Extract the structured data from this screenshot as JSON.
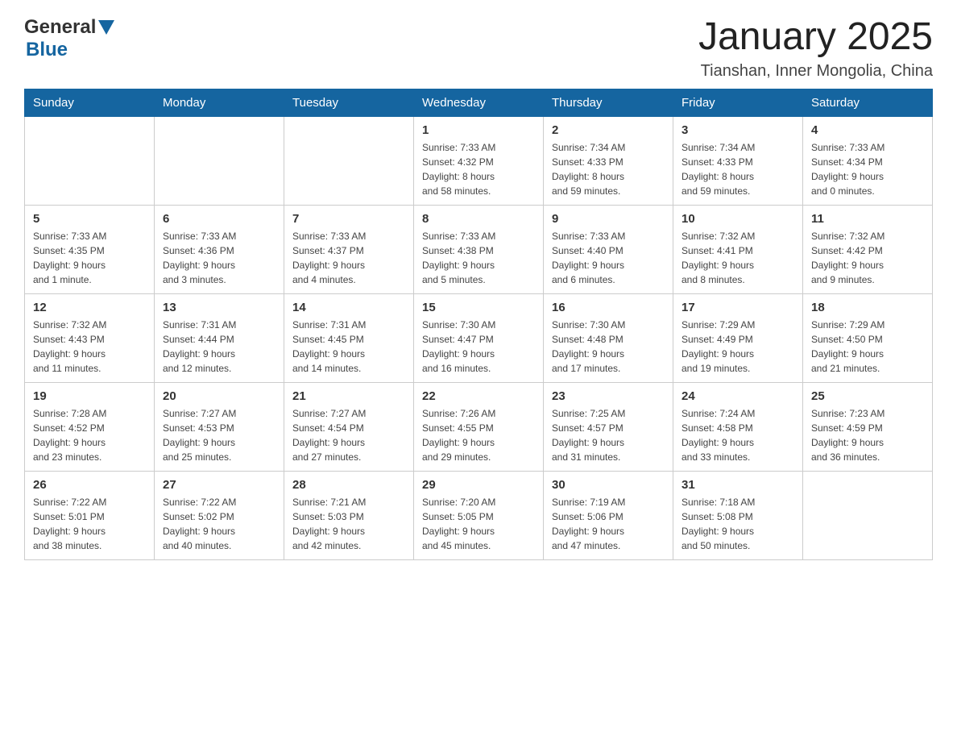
{
  "header": {
    "logo": {
      "text_general": "General",
      "text_blue": "Blue",
      "aria": "GeneralBlue Logo"
    },
    "title": "January 2025",
    "subtitle": "Tianshan, Inner Mongolia, China"
  },
  "calendar": {
    "days_of_week": [
      "Sunday",
      "Monday",
      "Tuesday",
      "Wednesday",
      "Thursday",
      "Friday",
      "Saturday"
    ],
    "weeks": [
      [
        {
          "day": "",
          "info": ""
        },
        {
          "day": "",
          "info": ""
        },
        {
          "day": "",
          "info": ""
        },
        {
          "day": "1",
          "info": "Sunrise: 7:33 AM\nSunset: 4:32 PM\nDaylight: 8 hours\nand 58 minutes."
        },
        {
          "day": "2",
          "info": "Sunrise: 7:34 AM\nSunset: 4:33 PM\nDaylight: 8 hours\nand 59 minutes."
        },
        {
          "day": "3",
          "info": "Sunrise: 7:34 AM\nSunset: 4:33 PM\nDaylight: 8 hours\nand 59 minutes."
        },
        {
          "day": "4",
          "info": "Sunrise: 7:33 AM\nSunset: 4:34 PM\nDaylight: 9 hours\nand 0 minutes."
        }
      ],
      [
        {
          "day": "5",
          "info": "Sunrise: 7:33 AM\nSunset: 4:35 PM\nDaylight: 9 hours\nand 1 minute."
        },
        {
          "day": "6",
          "info": "Sunrise: 7:33 AM\nSunset: 4:36 PM\nDaylight: 9 hours\nand 3 minutes."
        },
        {
          "day": "7",
          "info": "Sunrise: 7:33 AM\nSunset: 4:37 PM\nDaylight: 9 hours\nand 4 minutes."
        },
        {
          "day": "8",
          "info": "Sunrise: 7:33 AM\nSunset: 4:38 PM\nDaylight: 9 hours\nand 5 minutes."
        },
        {
          "day": "9",
          "info": "Sunrise: 7:33 AM\nSunset: 4:40 PM\nDaylight: 9 hours\nand 6 minutes."
        },
        {
          "day": "10",
          "info": "Sunrise: 7:32 AM\nSunset: 4:41 PM\nDaylight: 9 hours\nand 8 minutes."
        },
        {
          "day": "11",
          "info": "Sunrise: 7:32 AM\nSunset: 4:42 PM\nDaylight: 9 hours\nand 9 minutes."
        }
      ],
      [
        {
          "day": "12",
          "info": "Sunrise: 7:32 AM\nSunset: 4:43 PM\nDaylight: 9 hours\nand 11 minutes."
        },
        {
          "day": "13",
          "info": "Sunrise: 7:31 AM\nSunset: 4:44 PM\nDaylight: 9 hours\nand 12 minutes."
        },
        {
          "day": "14",
          "info": "Sunrise: 7:31 AM\nSunset: 4:45 PM\nDaylight: 9 hours\nand 14 minutes."
        },
        {
          "day": "15",
          "info": "Sunrise: 7:30 AM\nSunset: 4:47 PM\nDaylight: 9 hours\nand 16 minutes."
        },
        {
          "day": "16",
          "info": "Sunrise: 7:30 AM\nSunset: 4:48 PM\nDaylight: 9 hours\nand 17 minutes."
        },
        {
          "day": "17",
          "info": "Sunrise: 7:29 AM\nSunset: 4:49 PM\nDaylight: 9 hours\nand 19 minutes."
        },
        {
          "day": "18",
          "info": "Sunrise: 7:29 AM\nSunset: 4:50 PM\nDaylight: 9 hours\nand 21 minutes."
        }
      ],
      [
        {
          "day": "19",
          "info": "Sunrise: 7:28 AM\nSunset: 4:52 PM\nDaylight: 9 hours\nand 23 minutes."
        },
        {
          "day": "20",
          "info": "Sunrise: 7:27 AM\nSunset: 4:53 PM\nDaylight: 9 hours\nand 25 minutes."
        },
        {
          "day": "21",
          "info": "Sunrise: 7:27 AM\nSunset: 4:54 PM\nDaylight: 9 hours\nand 27 minutes."
        },
        {
          "day": "22",
          "info": "Sunrise: 7:26 AM\nSunset: 4:55 PM\nDaylight: 9 hours\nand 29 minutes."
        },
        {
          "day": "23",
          "info": "Sunrise: 7:25 AM\nSunset: 4:57 PM\nDaylight: 9 hours\nand 31 minutes."
        },
        {
          "day": "24",
          "info": "Sunrise: 7:24 AM\nSunset: 4:58 PM\nDaylight: 9 hours\nand 33 minutes."
        },
        {
          "day": "25",
          "info": "Sunrise: 7:23 AM\nSunset: 4:59 PM\nDaylight: 9 hours\nand 36 minutes."
        }
      ],
      [
        {
          "day": "26",
          "info": "Sunrise: 7:22 AM\nSunset: 5:01 PM\nDaylight: 9 hours\nand 38 minutes."
        },
        {
          "day": "27",
          "info": "Sunrise: 7:22 AM\nSunset: 5:02 PM\nDaylight: 9 hours\nand 40 minutes."
        },
        {
          "day": "28",
          "info": "Sunrise: 7:21 AM\nSunset: 5:03 PM\nDaylight: 9 hours\nand 42 minutes."
        },
        {
          "day": "29",
          "info": "Sunrise: 7:20 AM\nSunset: 5:05 PM\nDaylight: 9 hours\nand 45 minutes."
        },
        {
          "day": "30",
          "info": "Sunrise: 7:19 AM\nSunset: 5:06 PM\nDaylight: 9 hours\nand 47 minutes."
        },
        {
          "day": "31",
          "info": "Sunrise: 7:18 AM\nSunset: 5:08 PM\nDaylight: 9 hours\nand 50 minutes."
        },
        {
          "day": "",
          "info": ""
        }
      ]
    ]
  }
}
